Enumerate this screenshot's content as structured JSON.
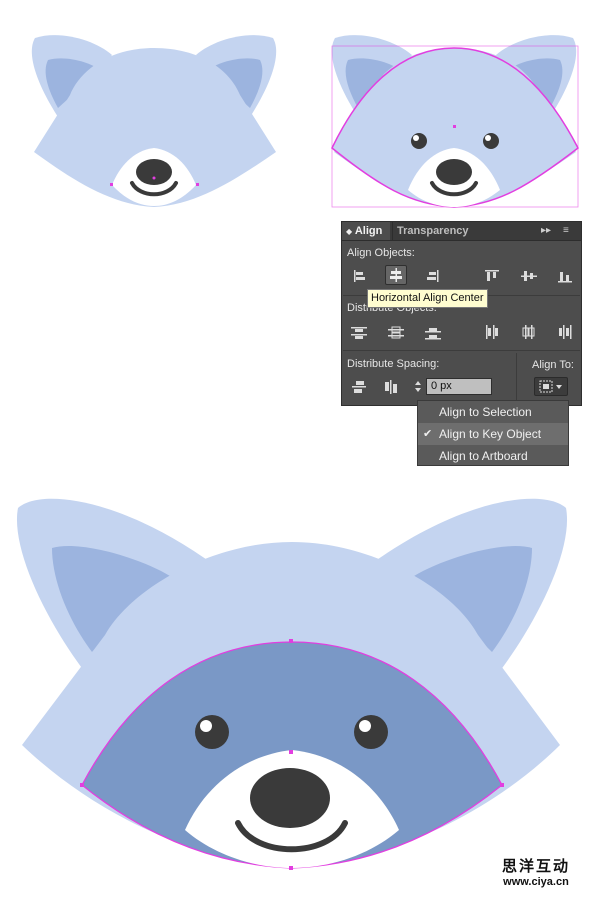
{
  "panel": {
    "tabs": [
      {
        "label": "Align",
        "active": true
      },
      {
        "label": "Transparency",
        "active": false
      }
    ],
    "sections": {
      "align_objects": "Align Objects:",
      "distribute_objects": "Distribute Objects:",
      "distribute_spacing": "Distribute Spacing:",
      "align_to": "Align To:"
    },
    "tooltip": "Horizontal Align Center",
    "spacing_value": "0 px",
    "align_to_menu": [
      {
        "label": "Align to Selection",
        "checked": false
      },
      {
        "label": "Align to Key Object",
        "checked": true
      },
      {
        "label": "Align to Artboard",
        "checked": false
      }
    ]
  },
  "watermark": {
    "text_cn": "思洋互动",
    "url": "www.ciya.cn"
  },
  "colors": {
    "head_light": "#c4d4f0",
    "ear_inner": "#9cb4df",
    "mask": "#7a98c6",
    "selection": "#e23ee0",
    "nose": "#3a3a3a",
    "panel_bg": "#4d4d4d"
  }
}
